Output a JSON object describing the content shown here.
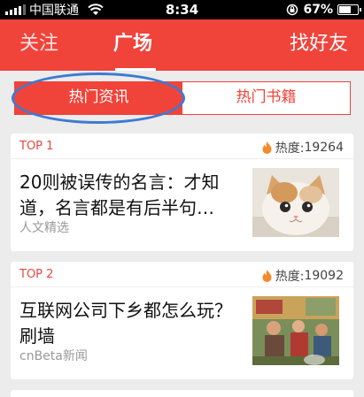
{
  "status_bar": {
    "carrier": "中国联通",
    "time": "8:34",
    "battery": "67%",
    "battery_level": 0.67
  },
  "top_nav": {
    "tabs": [
      "关注",
      "广场"
    ],
    "right_action": "找好友"
  },
  "segments": {
    "active": "热门资讯",
    "inactive": "热门书籍"
  },
  "heat_label": "热度:",
  "articles": [
    {
      "rank": "TOP 1",
      "heat": "19264",
      "title": "20则被误传的名言：才知道，名言都是有后半句…",
      "source": "人文精选",
      "thumb_icon": "kitten-photo"
    },
    {
      "rank": "TOP 2",
      "heat": "19092",
      "title": "互联网公司下乡都怎么玩？刷墙",
      "source": "cnBeta新闻",
      "thumb_icon": "propaganda-poster-photo"
    }
  ],
  "colors": {
    "brand_red": "#f0433a",
    "annotation_blue": "#3c7bd3"
  }
}
